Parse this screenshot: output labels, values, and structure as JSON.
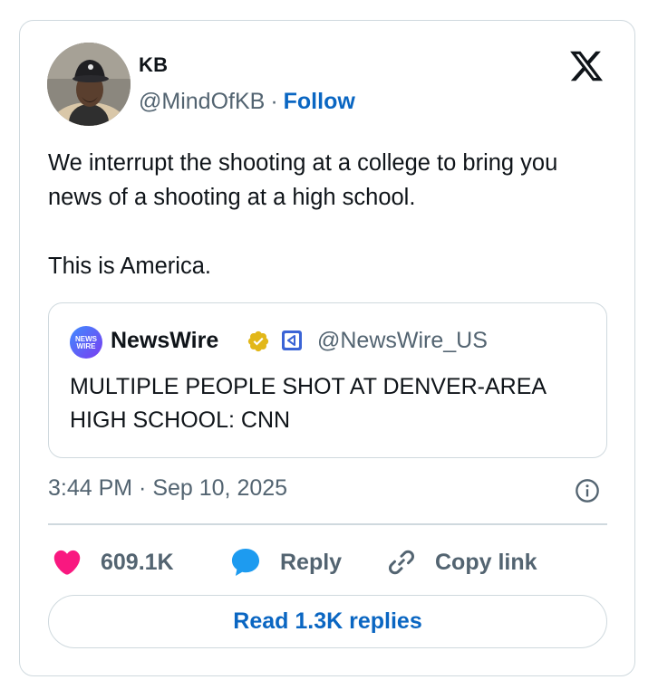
{
  "author": {
    "name": "KB",
    "handle": "@MindOfKB",
    "separator": "·",
    "follow_label": "Follow"
  },
  "tweet": {
    "text": "We interrupt the shooting at a college to bring you news of a shooting at a high school.\n\nThis is America."
  },
  "quoted": {
    "logo_text_top": "NEWS",
    "logo_text_bottom": "WIRE",
    "name": "NewsWire",
    "handle": "@NewsWire_US",
    "text": "MULTIPLE PEOPLE SHOT AT DENVER-AREA HIGH SCHOOL: CNN"
  },
  "meta": {
    "timestamp": "3:44 PM · Sep 10, 2025"
  },
  "actions": {
    "like_count": "609.1K",
    "reply_label": "Reply",
    "copy_label": "Copy link"
  },
  "read_replies_label": "Read 1.3K replies",
  "colors": {
    "accent": "#0a66c2",
    "like": "#f91880",
    "reply": "#1d9bf0",
    "border": "#cfd9de",
    "muted": "#536471"
  },
  "icons": {
    "logo": "x-logo-icon",
    "verified": "verified-badge-icon",
    "affiliate": "affiliate-badge-icon",
    "info": "info-icon",
    "like": "heart-icon",
    "reply": "speech-bubble-icon",
    "copy": "link-icon"
  }
}
